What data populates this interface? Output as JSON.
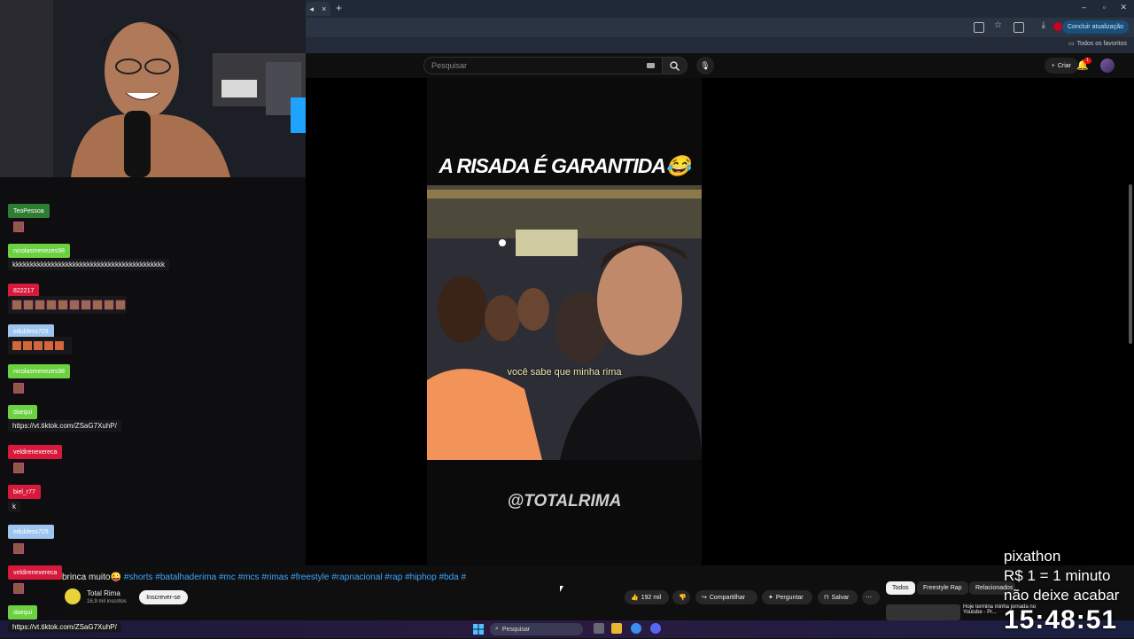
{
  "browser": {
    "tab_close": "×",
    "new_tab": "+",
    "update_button": "Concluir atualização",
    "bookmarks_label": "Todos os favoritos"
  },
  "youtube": {
    "search_placeholder": "Pesquisar",
    "create_label": "Criar",
    "notification_count": "1"
  },
  "video": {
    "overlay_title": "A RISADA É GARANTIDA😂",
    "subtitle": "você sabe que minha rima",
    "watermark": "@TOTALRIMA",
    "description_start": "brinca muito😜",
    "hashtags": "#shorts #batalhaderima #mc #mcs #rimas #freestyle #rapnacional #rap #hiphop #bda #",
    "channel_name": "Total Rima",
    "channel_subs": "16,9 mil inscritos",
    "subscribe_label": "Inscrever-se",
    "likes": "192 mil",
    "share_label": "Compartilhar",
    "ask_label": "Perguntar",
    "save_label": "Salvar"
  },
  "recommend_chips": [
    "Todos",
    "Freestyle Rap",
    "Relacionados"
  ],
  "recommended": {
    "title": "Hoje termina minha jornada no Youtube - Pr..."
  },
  "chat": {
    "messages": [
      {
        "user": "TeoPessoa",
        "color": "#2e7d32",
        "text": ""
      },
      {
        "user": "nicolasmenezes98",
        "color": "#6bd140",
        "text": "kkkkkkkkkkkkkkkkkkkkkkkkkkkkkkkkkkkkkkkkkkk"
      },
      {
        "user": "822217",
        "color": "#d7193c",
        "text": ""
      },
      {
        "user": "edubless729",
        "color": "#9ec5f0",
        "text": ""
      },
      {
        "user": "nicolasmenezes98",
        "color": "#6bd140",
        "text": ""
      },
      {
        "user": "daequi",
        "color": "#6bd140",
        "text": "https://vt.tiktok.com/ZSaG7XuhP/"
      },
      {
        "user": "veldirenexereca",
        "color": "#d7193c",
        "text": ""
      },
      {
        "user": "biel_r77",
        "color": "#d7193c",
        "text": "k"
      },
      {
        "user": "edubless729",
        "color": "#9ec5f0",
        "text": ""
      },
      {
        "user": "veldirenexereca",
        "color": "#d7193c",
        "text": ""
      },
      {
        "user": "daequi",
        "color": "#6bd140",
        "text": "https://vt.tiktok.com/ZSaG7XuhP/"
      }
    ]
  },
  "taskbar": {
    "search_label": "Pesquisar"
  },
  "overlay": {
    "line1": "pixathon",
    "line2": "R$ 1 = 1 minuto",
    "line3": "não deixe acabar",
    "clock": "15:48:51"
  }
}
